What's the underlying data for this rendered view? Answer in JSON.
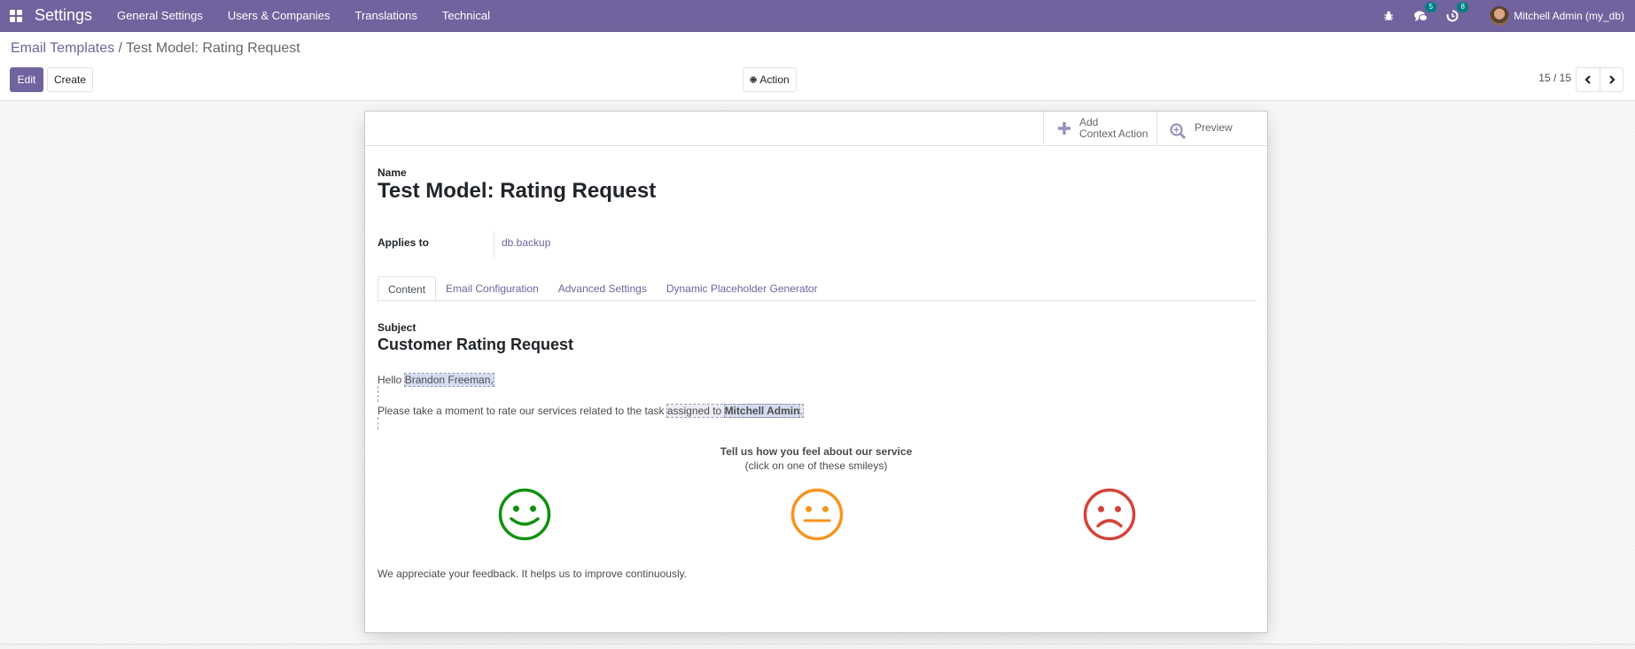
{
  "navbar": {
    "app_name": "Settings",
    "menu": [
      "General Settings",
      "Users & Companies",
      "Translations",
      "Technical"
    ],
    "messages_count": "5",
    "activities_count": "8",
    "user": "Mitchell Admin (my_db)",
    "icons": [
      "apps-icon",
      "bug-icon",
      "chat-icon",
      "clock-icon"
    ]
  },
  "control": {
    "breadcrumb_parent": "Email Templates",
    "breadcrumb_sep": " / ",
    "breadcrumb_current": "Test Model: Rating Request",
    "edit_label": "Edit",
    "create_label": "Create",
    "action_label": "Action",
    "pager": "15 / 15"
  },
  "sheet": {
    "smart_buttons": {
      "add_line1": "Add",
      "add_line2": "Context Action",
      "preview": "Preview"
    },
    "name_label": "Name",
    "name_value": "Test Model: Rating Request",
    "applies_label": "Applies to",
    "applies_value": "db.backup",
    "tabs": [
      "Content",
      "Email Configuration",
      "Advanced Settings",
      "Dynamic Placeholder Generator"
    ],
    "active_tab": "Content",
    "subject_label": "Subject",
    "subject_value": "Customer Rating Request",
    "body": {
      "hello": "Hello ",
      "customer": "Brandon Freeman,",
      "line2_start": "Please take a moment to rate our services related to the task ",
      "assigned_prefix": "assigned to ",
      "assignee": "Mitchell Admin",
      "period": ".",
      "tell_us": "Tell us how you feel about our service",
      "click_hint": "(click on one of these smileys)",
      "smileys": [
        {
          "mood": "satisfied",
          "color": "#119010"
        },
        {
          "mood": "okay",
          "color": "#f7941d"
        },
        {
          "mood": "dissatisfied",
          "color": "#d44238"
        }
      ],
      "closing": "We appreciate your feedback. It helps us to improve continuously."
    }
  }
}
